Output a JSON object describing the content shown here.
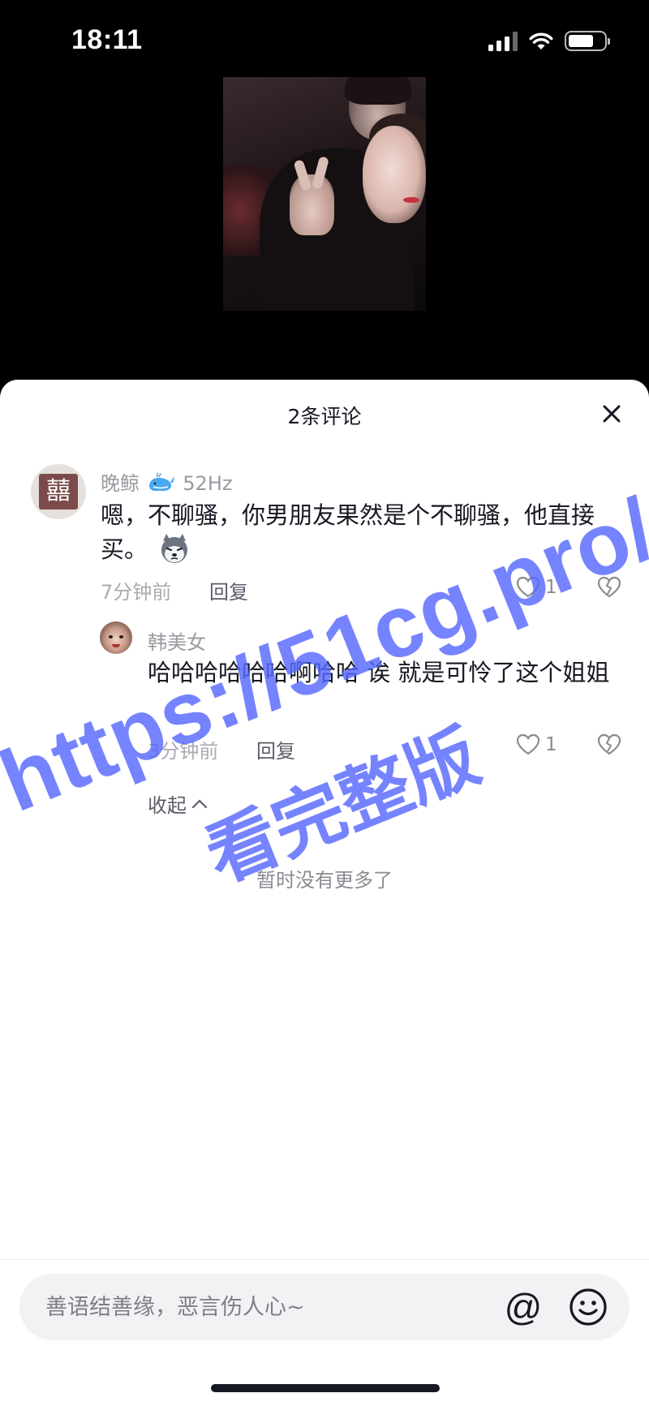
{
  "status_bar": {
    "time": "18:11",
    "icons": [
      "signal-icon",
      "wifi-icon",
      "battery-icon"
    ]
  },
  "video": {
    "description_icon": "video-thumbnail"
  },
  "comments_panel": {
    "title": "2条评论",
    "close_icon": "close-icon",
    "comments": [
      {
        "username": "晚鲸",
        "username_suffix": "52Hz",
        "text": "嗯，不聊骚，你男朋友果然是个不聊骚，他直接买。",
        "emoji_icon": "husky-emoji-icon",
        "time": "7分钟前",
        "reply_label": "回复",
        "likes": "1",
        "replies": [
          {
            "username": "韩美女",
            "text": "哈哈哈哈哈哈啊哈哈 诶 就是可怜了这个姐姐",
            "time": "3分钟前",
            "reply_label": "回复",
            "likes": "1"
          }
        ]
      }
    ],
    "collapse_label": "收起",
    "no_more_label": "暂时没有更多了"
  },
  "watermark": {
    "line1": "https://51cg.pro/",
    "line2": "看完整版"
  },
  "input_bar": {
    "placeholder": "善语结善缘，恶言伤人心~",
    "at_symbol": "@"
  },
  "colors": {
    "watermark": "#5868ff",
    "sheet_bg": "#ffffff",
    "muted_text": "#999aa1"
  }
}
